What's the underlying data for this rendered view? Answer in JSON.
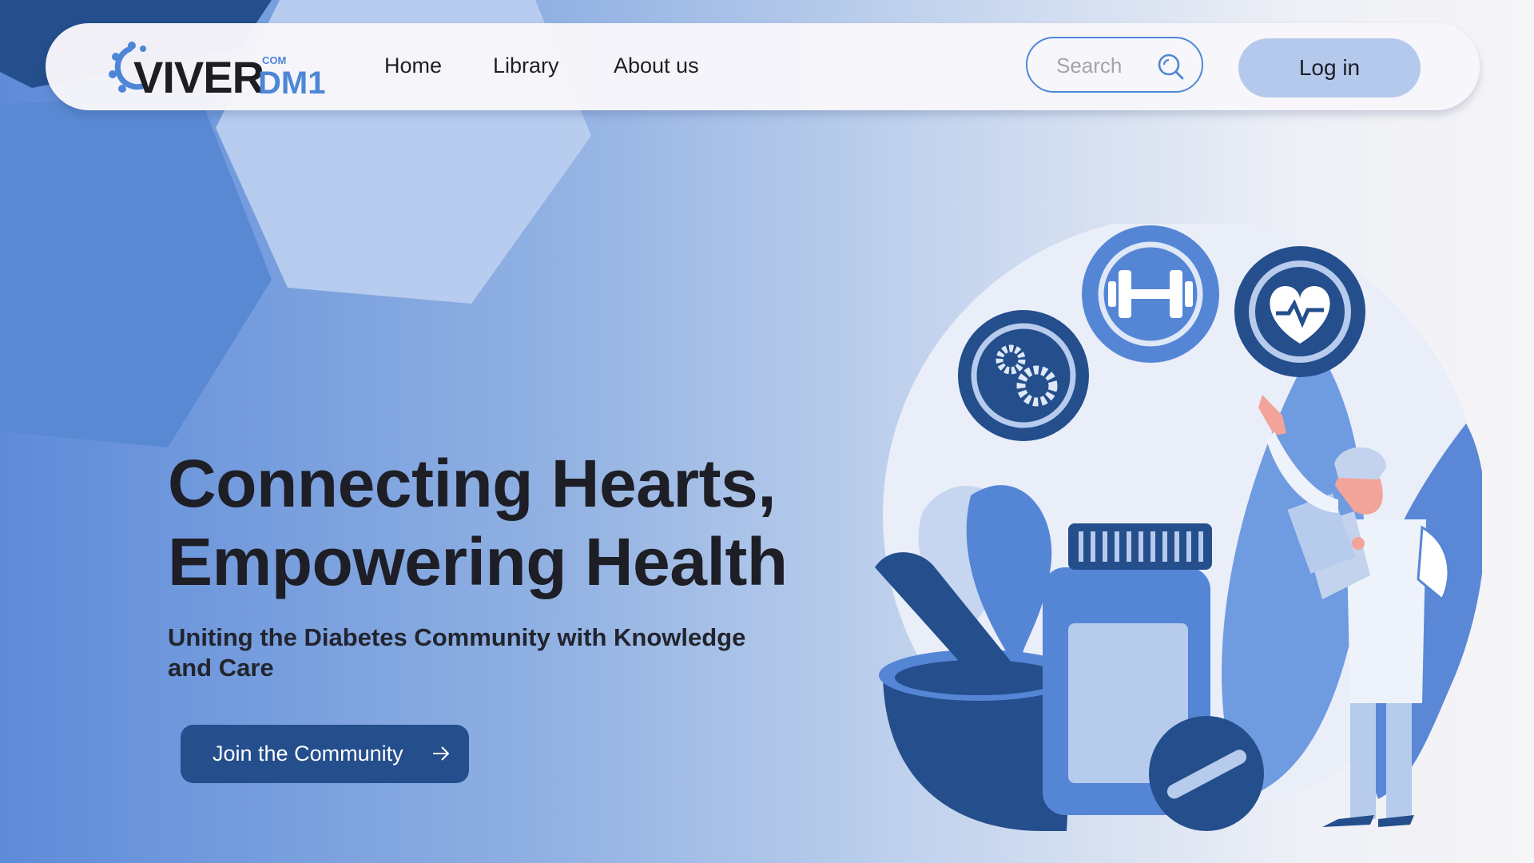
{
  "header": {
    "logo": {
      "brand": "VIVER",
      "superscript": "COM",
      "suffix": "DM1"
    },
    "nav": [
      {
        "label": "Home"
      },
      {
        "label": "Library"
      },
      {
        "label": "About us"
      }
    ],
    "search": {
      "placeholder": "Search",
      "value": ""
    },
    "login_label": "Log in"
  },
  "hero": {
    "title_line1": "Connecting Hearts,",
    "title_line2": "Empowering Health",
    "subtitle_line1": "Uniting the Diabetes Community with Knowledge",
    "subtitle_line2": "and Care",
    "cta_label": "Join the Community"
  },
  "icons": {
    "search": "search-icon",
    "cta": "arrow-right-icon",
    "illustration_badges": [
      "gears-icon",
      "dumbbell-icon",
      "heart-pulse-icon"
    ]
  },
  "colors": {
    "accent": "#4e86d6",
    "cta_background": "#244e8c",
    "login_background": "#b4c9ec",
    "navy": "#244e8c"
  }
}
